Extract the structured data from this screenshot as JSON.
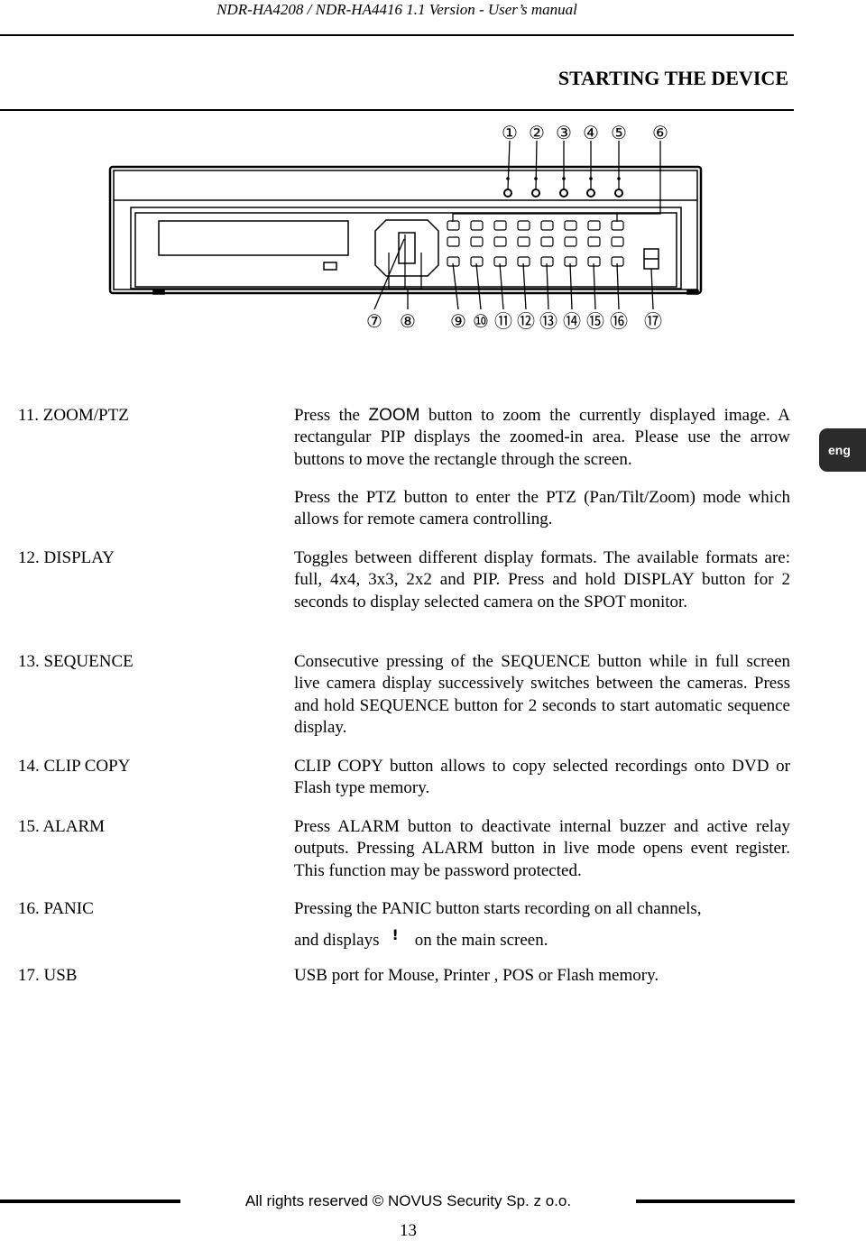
{
  "header": {
    "manual_title": "NDR-HA4208 / NDR-HA4416 1.1 Version - User’s manual"
  },
  "section_title": "STARTING THE DEVICE",
  "diagram": {
    "top_callouts": [
      "①",
      "②",
      "③",
      "④",
      "⑤",
      "⑥"
    ],
    "bottom_callouts": [
      "⑦",
      "⑧",
      "⑨",
      "⑩",
      "⑪",
      "⑫",
      "⑬",
      "⑭",
      "⑮",
      "⑯",
      "⑰"
    ]
  },
  "language_tab": "eng",
  "items": [
    {
      "label": "11. ZOOM/PTZ",
      "p1_before": "Press the ",
      "p1_zoom": "ZOOM",
      "p1_after": " button to zoom the currently displayed image. A rectangular PIP displays  the zoomed-in area. Please use the arrow buttons to move the rectangle through the screen.",
      "p2": "Press the PTZ button to enter the PTZ (Pan/Tilt/Zoom) mode which allows for remote camera controlling."
    },
    {
      "label": "12. DISPLAY",
      "text": "Toggles between different display formats. The available formats are: full,  4x4,  3x3,  2x2  and PIP.  Press and hold DISPLAY button for 2 seconds to display selected camera on the SPOT monitor."
    },
    {
      "label": "13. SEQUENCE",
      "text": "Consecutive pressing of the SEQUENCE button while in full screen live camera display successively switches between the cameras. Press and hold SEQUENCE button for 2 seconds to start automatic sequence display."
    },
    {
      "label": "14. CLIP COPY",
      "text": "CLIP COPY button allows to copy selected recordings onto DVD or Flash type memory."
    },
    {
      "label": "15. ALARM",
      "text": "Press ALARM button to deactivate internal buzzer and active relay outputs. Pressing ALARM button in live mode opens event register. This function may be password protected."
    },
    {
      "label": "16. PANIC",
      "line1": "Pressing the PANIC button starts recording on all channels,",
      "line2_before": "and displays",
      "icon": "exclamation-icon",
      "line2_after": "on the main screen."
    },
    {
      "label": "17. USB",
      "text": "USB port for Mouse, Printer , POS or Flash memory."
    }
  ],
  "footer": {
    "copyright": "All rights reserved © NOVUS Security Sp. z o.o.",
    "page_number": "13"
  }
}
